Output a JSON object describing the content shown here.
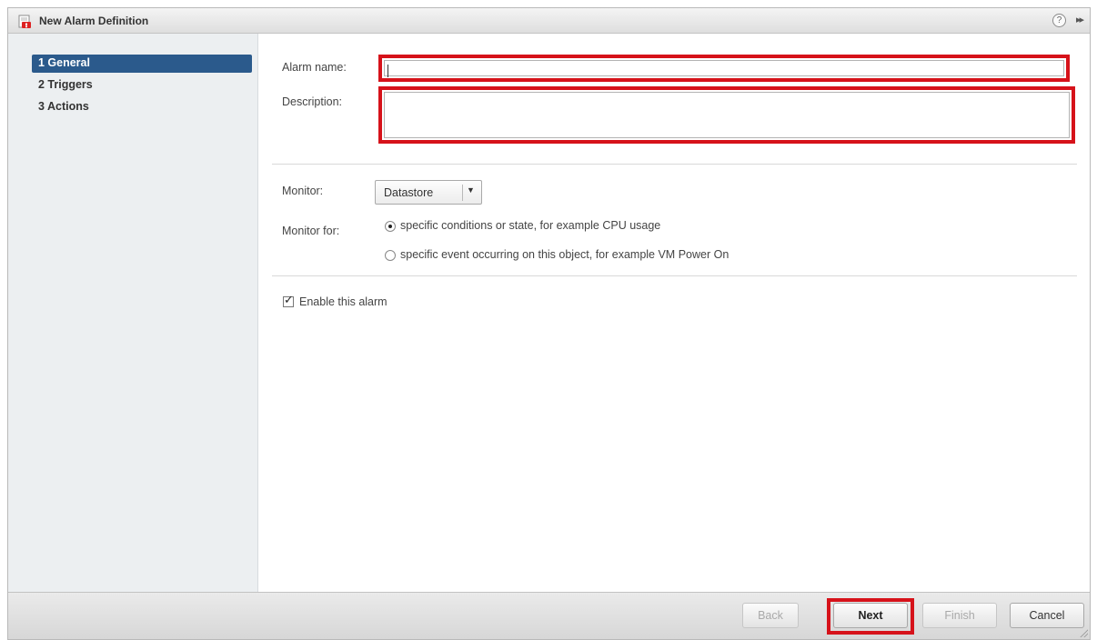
{
  "window": {
    "title": "New Alarm Definition",
    "help": "?",
    "expand": "▸▸"
  },
  "steps": [
    {
      "label": "1 General",
      "active": true
    },
    {
      "label": "2 Triggers",
      "active": false
    },
    {
      "label": "3 Actions",
      "active": false
    }
  ],
  "form": {
    "alarm_name_label": "Alarm name:",
    "alarm_name_value": "",
    "description_label": "Description:",
    "description_value": "",
    "monitor_label": "Monitor:",
    "monitor_value": "Datastore",
    "monitor_for_label": "Monitor for:",
    "monitor_for_options": [
      {
        "label": "specific conditions or state, for example CPU usage",
        "checked": true
      },
      {
        "label": "specific event occurring on this object, for example VM Power On",
        "checked": false
      }
    ],
    "enable_label": "Enable this alarm",
    "enable_checked": true
  },
  "footer": {
    "back": "Back",
    "next": "Next",
    "finish": "Finish",
    "cancel": "Cancel"
  },
  "colors": {
    "highlight": "#d6121a",
    "active_step": "#2b5a8c",
    "sidebar_bg": "#eceff1"
  }
}
